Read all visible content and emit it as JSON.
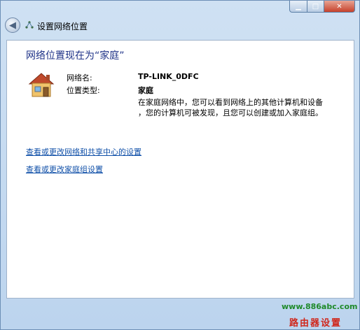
{
  "window": {
    "title": "设置网络位置",
    "controls": {
      "minimize": "▁",
      "maximize": "□",
      "close": "✕"
    }
  },
  "main": {
    "heading": "网络位置现在为“家庭”",
    "network_name_label": "网络名:",
    "network_name_value": "TP-LINK_0DFC",
    "location_type_label": "位置类型:",
    "location_type_value": "家庭",
    "description_line1": "在家庭网络中，您可以看到网络上的其他计算机和设备",
    "description_line2": "，您的计算机可被发现，且您可以创建或加入家庭组。"
  },
  "links": {
    "network_center": "查看或更改网络和共享中心的设置",
    "homegroup": "查看或更改家庭组设置"
  },
  "watermark": {
    "url": "www.886abc.com",
    "text": "路由器设置"
  }
}
